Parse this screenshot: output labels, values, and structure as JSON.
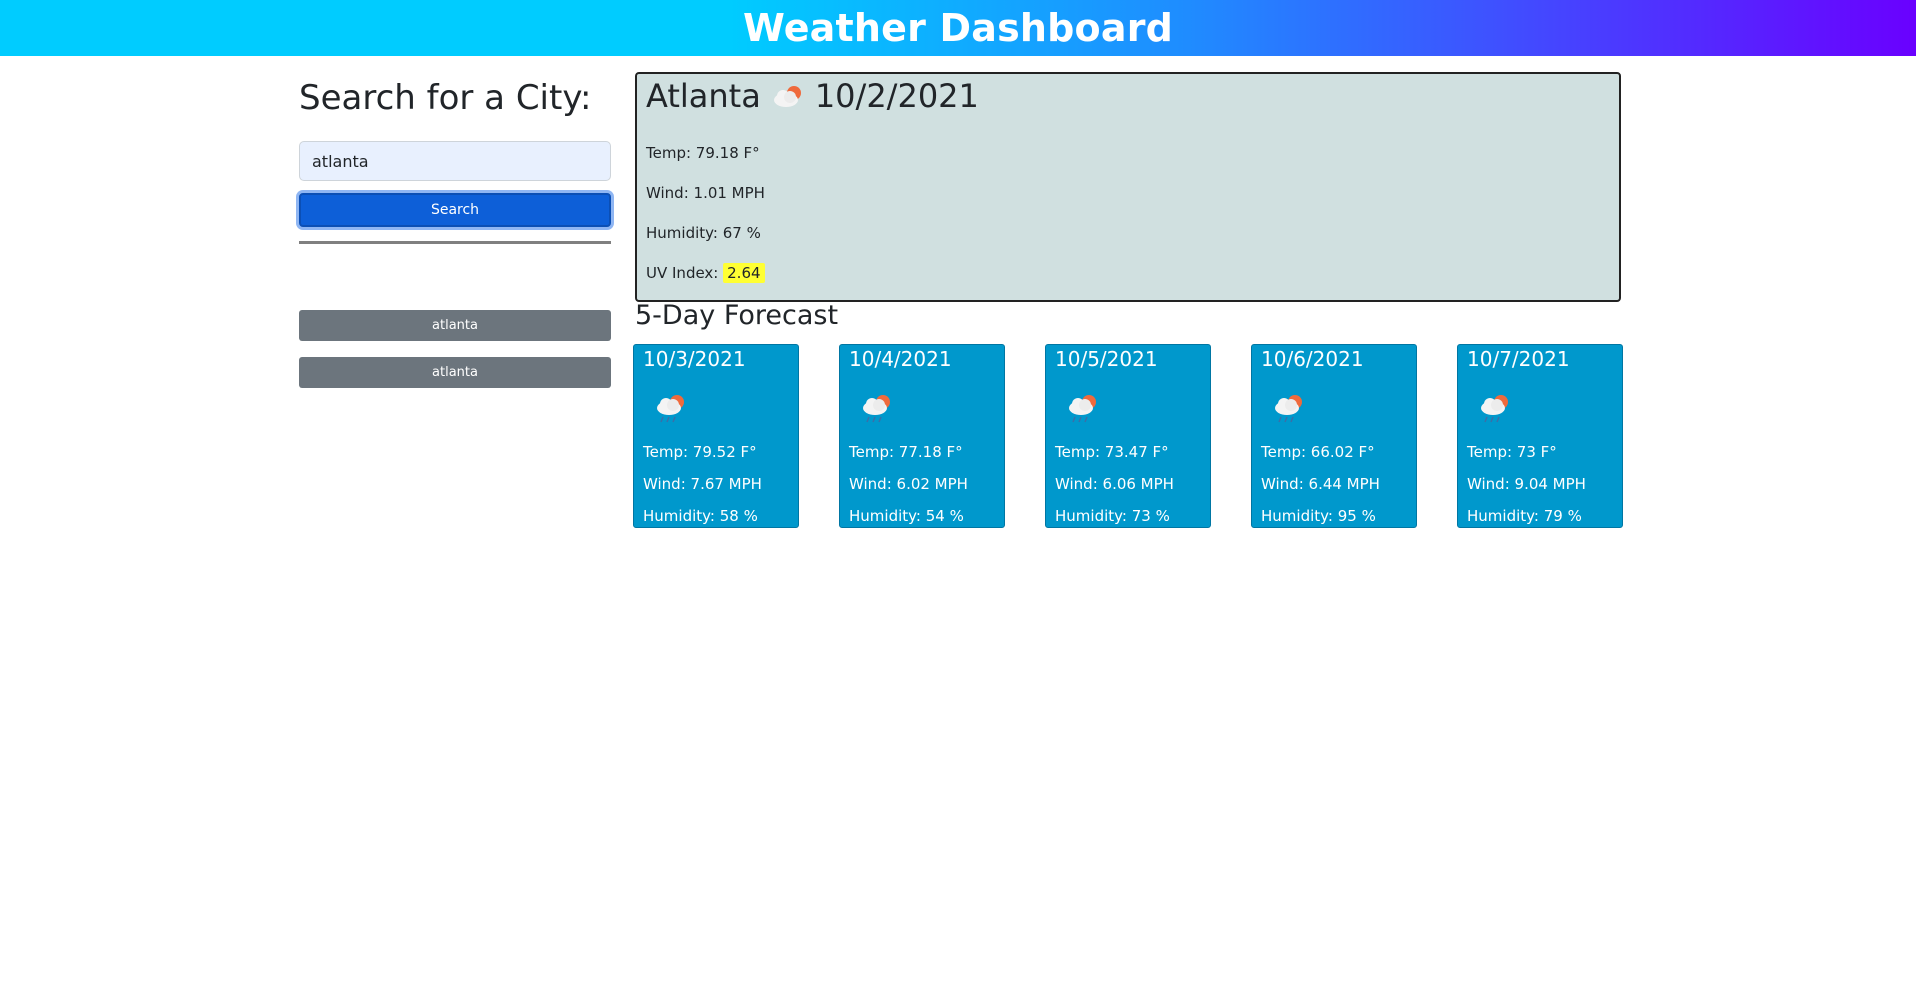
{
  "header": {
    "title": "Weather Dashboard"
  },
  "sidebar": {
    "heading": "Search for a City:",
    "search_value": "atlanta",
    "search_button": "Search",
    "history": [
      "atlanta",
      "atlanta"
    ]
  },
  "current": {
    "city": "Atlanta",
    "icon": "cloud-sun-rain-icon",
    "date": "10/2/2021",
    "temp": "Temp: 79.18 F°",
    "wind": "Wind: 1.01 MPH",
    "humidity": "Humidity: 67 %",
    "uv_label": "UV Index:",
    "uv_value": "2.64"
  },
  "forecast": {
    "title": "5-Day Forecast",
    "days": [
      {
        "date": "10/3/2021",
        "icon": "cloud-sun-rain-icon",
        "temp": "Temp: 79.52 F°",
        "wind": "Wind: 7.67 MPH",
        "humidity": "Humidity: 58 %"
      },
      {
        "date": "10/4/2021",
        "icon": "cloud-sun-rain-icon",
        "temp": "Temp: 77.18 F°",
        "wind": "Wind: 6.02 MPH",
        "humidity": "Humidity: 54 %"
      },
      {
        "date": "10/5/2021",
        "icon": "cloud-sun-rain-icon",
        "temp": "Temp: 73.47 F°",
        "wind": "Wind: 6.06 MPH",
        "humidity": "Humidity: 73 %"
      },
      {
        "date": "10/6/2021",
        "icon": "cloud-sun-rain-icon",
        "temp": "Temp: 66.02 F°",
        "wind": "Wind: 6.44 MPH",
        "humidity": "Humidity: 95 %"
      },
      {
        "date": "10/7/2021",
        "icon": "cloud-sun-rain-icon",
        "temp": "Temp: 73 F°",
        "wind": "Wind: 9.04 MPH",
        "humidity": "Humidity: 79 %"
      }
    ]
  },
  "colors": {
    "header_gradient_start": "#00ccff",
    "header_gradient_end": "#6a00ff",
    "search_button": "#0d5fd8",
    "history_button": "#6c757d",
    "current_panel": "#d0e0e0",
    "forecast_card": "#0098cc",
    "uv_badge": "#ffff33"
  }
}
